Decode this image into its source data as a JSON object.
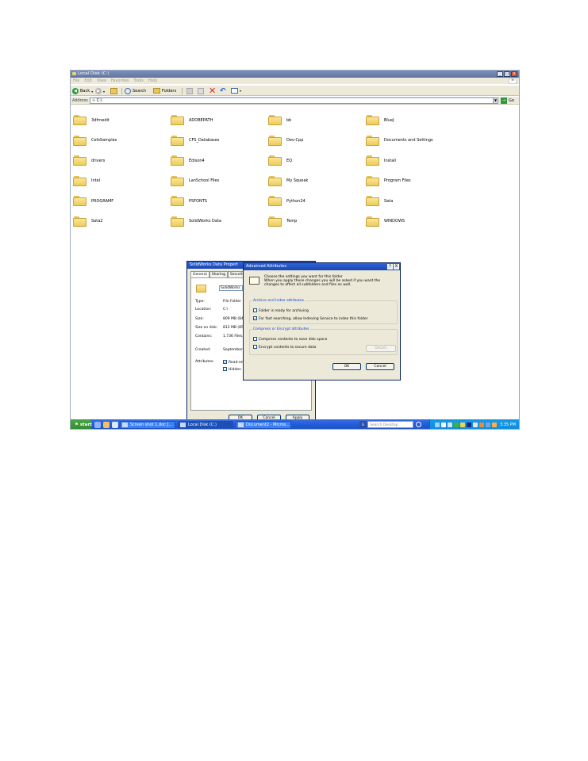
{
  "window": {
    "title": "Local Disk (C:)",
    "controls": {
      "min": "_",
      "max": "□",
      "close": "x"
    }
  },
  "menu": [
    "File",
    "Edit",
    "View",
    "Favorites",
    "Tools",
    "Help"
  ],
  "toolbar": {
    "back": "Back",
    "search": "Search",
    "folders": "Folders"
  },
  "address": {
    "label": "Address",
    "value": "C:\\",
    "go": "Go"
  },
  "folders": [
    "3dfrnedit",
    "ADOBEPATH",
    "bb",
    "BlueJ",
    "CefsSamples",
    "CFS_Databases",
    "Dev-Cpp",
    "Documents and Settings",
    "drivers",
    "Edison4",
    "EQ",
    "Install",
    "Intel",
    "LanSchool Files",
    "My Squeak",
    "Program Files",
    "PROGRAMF",
    "PSFONTS",
    "Python24",
    "Sata",
    "Sata2",
    "SolidWorks Data",
    "Temp",
    "WINDOWS"
  ],
  "properties": {
    "title": "SolidWorks Data Propert",
    "tabs": [
      "General",
      "Sharing",
      "Security"
    ],
    "name": "SolidWorks",
    "rows": [
      {
        "k": "Type:",
        "v": "File Folder"
      },
      {
        "k": "Location:",
        "v": "C:\\"
      },
      {
        "k": "Size:",
        "v": "809 MB (848"
      },
      {
        "k": "Size on disk:",
        "v": "812 MB (851"
      },
      {
        "k": "Contains:",
        "v": "1,736 Files,"
      },
      {
        "k": "Created:",
        "v": "September 9"
      },
      {
        "k": "Attributes:",
        "v": "Read-on"
      },
      {
        "k": "",
        "v": "Hidden"
      }
    ],
    "buttons": {
      "ok": "OK",
      "cancel": "Cancel",
      "apply": "Apply"
    }
  },
  "advanced": {
    "title": "Advanced Attributes",
    "controls": {
      "help": "?",
      "close": "X"
    },
    "desc1": "Choose the settings you want for this folder",
    "desc2": "When you apply these changes you will be asked if you want the changes to affect all subfolders and files as well.",
    "group1": {
      "title": "Archive and Index attributes",
      "opt1": "Folder is ready for archiving",
      "opt2": "For fast searching, allow Indexing Service to index this folder"
    },
    "group2": {
      "title": "Compress or Encrypt attributes",
      "opt1": "Compress contents to save disk space",
      "opt2": "Encrypt contents to secure data",
      "details": "Details"
    },
    "buttons": {
      "ok": "OK",
      "cancel": "Cancel"
    }
  },
  "taskbar": {
    "start": "start",
    "tasks": [
      "Screen shot 1.doc [...",
      "Local Disk (C:)",
      "Document2 - Micros..."
    ],
    "search_placeholder": "Search Desktop",
    "clock": "3:35 PM"
  }
}
